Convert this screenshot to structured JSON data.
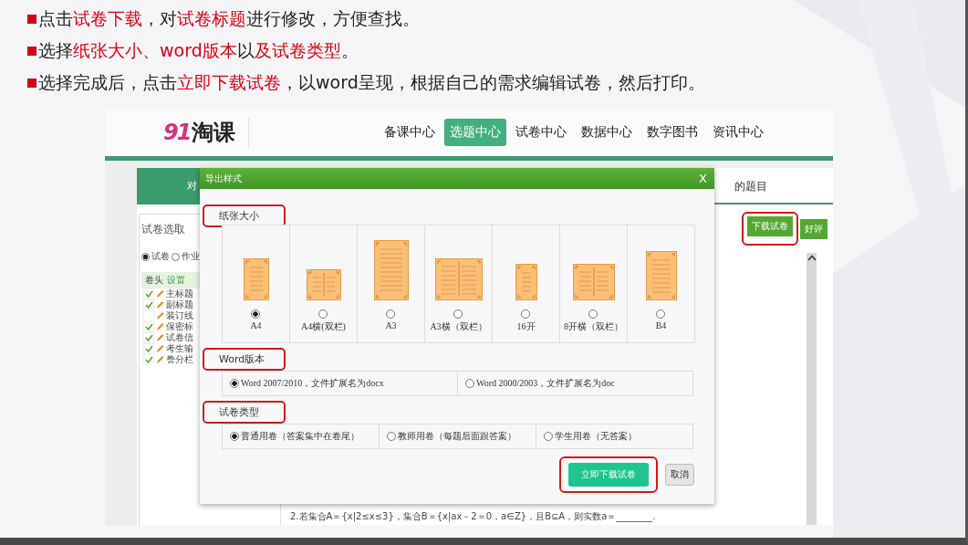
{
  "slide": {
    "bullets": [
      [
        {
          "text": "点击",
          "highlight": false
        },
        {
          "text": "试卷下载",
          "highlight": true
        },
        {
          "text": "，对",
          "highlight": false
        },
        {
          "text": "试卷标题",
          "highlight": true
        },
        {
          "text": "进行修改，方便查找。",
          "highlight": false
        }
      ],
      [
        {
          "text": "选择",
          "highlight": false
        },
        {
          "text": "纸张大小、word版本",
          "highlight": true
        },
        {
          "text": "以",
          "highlight": false
        },
        {
          "text": "及试卷类型",
          "highlight": true
        },
        {
          "text": "。",
          "highlight": false
        }
      ],
      [
        {
          "text": "选择完成后，点击",
          "highlight": false
        },
        {
          "text": "立即下载试卷",
          "highlight": true
        },
        {
          "text": "，以word呈现，根据自己的需求编辑试卷，然后打印。",
          "highlight": false
        }
      ]
    ]
  },
  "site": {
    "logo": {
      "digits": "91",
      "name": "淘课"
    },
    "nav": [
      {
        "label": "备课中心",
        "selected": false
      },
      {
        "label": "选题中心",
        "selected": true
      },
      {
        "label": "试卷中心",
        "selected": false
      },
      {
        "label": "数据中心",
        "selected": false
      },
      {
        "label": "数字图书",
        "selected": false
      },
      {
        "label": "资讯中心",
        "selected": false
      }
    ],
    "tabs": [
      {
        "label": "对",
        "selected": true
      },
      {
        "label": "的题目",
        "selected": false
      }
    ],
    "paper_panel": {
      "title": "试卷选取",
      "modes": [
        {
          "label": "试卷",
          "selected": true
        },
        {
          "label": "作业",
          "selected": false
        }
      ],
      "columns": [
        "卷头",
        "设置"
      ],
      "items": [
        {
          "label": "主标题",
          "checked": true
        },
        {
          "label": "副标题",
          "checked": true
        },
        {
          "label": "装订线",
          "checked": false
        },
        {
          "label": "保密标",
          "checked": true
        },
        {
          "label": "试卷信",
          "checked": true
        },
        {
          "label": "考生输",
          "checked": true
        },
        {
          "label": "誊分栏",
          "checked": true
        }
      ]
    },
    "actions": [
      {
        "label": "下载试卷",
        "annotated": true
      },
      {
        "label": "好评",
        "annotated": false
      }
    ],
    "question": "2.若集合A＝{x|2≤x≤3}，集合B＝{x|ax－2＝0，a∈Z}，且B⊆A，则实数a＝________."
  },
  "dialog": {
    "title": "导出样式",
    "close": "X",
    "sections": [
      {
        "title": "纸张大小",
        "annotated": true,
        "kind": "paper",
        "options": [
          {
            "label": "A4",
            "selected": true
          },
          {
            "label": "A4横(双栏)",
            "selected": false
          },
          {
            "label": "A3",
            "selected": false
          },
          {
            "label": "A3横（双栏）",
            "selected": false
          },
          {
            "label": "16开",
            "selected": false
          },
          {
            "label": "8开横（双栏）",
            "selected": false
          },
          {
            "label": "B4",
            "selected": false
          }
        ]
      },
      {
        "title": "Word版本",
        "annotated": true,
        "kind": "row",
        "options": [
          {
            "label": "Word 2007/2010，文件扩展名为docx",
            "selected": true
          },
          {
            "label": "Word 2000/2003，文件扩展名为doc",
            "selected": false
          }
        ]
      },
      {
        "title": "试卷类型",
        "annotated": true,
        "kind": "row",
        "options": [
          {
            "label": "普通用卷（答案集中在卷尾）",
            "selected": true
          },
          {
            "label": "教师用卷（每题后面跟答案）",
            "selected": false
          },
          {
            "label": "学生用卷（无答案）",
            "selected": false
          }
        ]
      }
    ],
    "buttons": [
      {
        "label": "立即下载试卷",
        "kind": "primary",
        "annotated": true
      },
      {
        "label": "取消",
        "kind": "secondary",
        "annotated": false
      }
    ]
  }
}
